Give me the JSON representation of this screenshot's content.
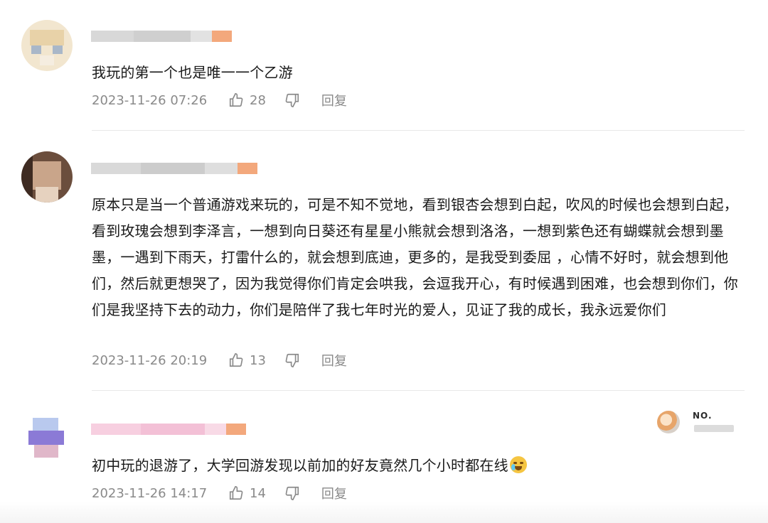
{
  "comments": [
    {
      "text": "我玩的第一个也是唯一一个乙游",
      "time": "2023-11-26 07:26",
      "likes": "28",
      "reply": "回复"
    },
    {
      "text": "原本只是当一个普通游戏来玩的，可是不知不觉地，看到银杏会想到白起，吹风的时候也会想到白起，看到玫瑰会想到李泽言，一想到向日葵还有星星小熊就会想到洛洛，一想到紫色还有蝴蝶就会想到墨墨，一遇到下雨天，打雷什么的，就会想到底迪，更多的，是我受到委屈 ，心情不好时，就会想到他们，然后就更想哭了，因为我觉得你们肯定会哄我，会逗我开心，有时候遇到困难，也会想到你们，你们是我坚持下去的动力，你们是陪伴了我七年时光的爱人，见证了我的成长，我永远爱你们",
      "time": "2023-11-26 20:19",
      "likes": "13",
      "reply": "回复"
    },
    {
      "text": "初中玩的退游了，大学回游发现以前加的好友竟然几个小时都在线",
      "time": "2023-11-26 14:17",
      "likes": "14",
      "reply": "回复",
      "emoji": "crying-face-emoji"
    }
  ],
  "badge": {
    "label": "NO."
  },
  "colors": {
    "meta": "#8a8a8a",
    "text": "#1a1a1a",
    "divider": "#e8e8e8"
  }
}
